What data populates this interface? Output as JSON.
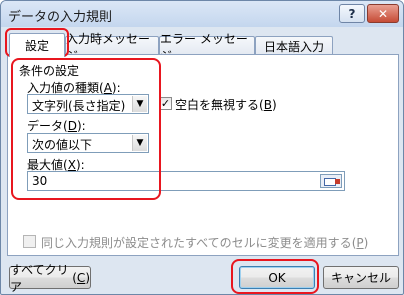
{
  "window": {
    "title": "データの入力規則",
    "help_label": "?",
    "close_label": "✕"
  },
  "tabs": [
    {
      "label": "設定",
      "active": true
    },
    {
      "label": "入力時メッセージ",
      "active": false
    },
    {
      "label": "エラー メッセージ",
      "active": false
    },
    {
      "label": "日本語入力",
      "active": false
    }
  ],
  "conditions": {
    "section_title": "条件の設定",
    "allow_label": "入力値の種類",
    "allow_key": "A",
    "allow_value": "文字列(長さ指定)",
    "ignore_blank_label": "空白を無視する",
    "ignore_blank_key": "B",
    "ignore_blank_checked": true,
    "data_label": "データ",
    "data_key": "D",
    "data_value": "次の値以下",
    "max_label": "最大値",
    "max_key": "X",
    "max_value": "30"
  },
  "apply_all": {
    "label": "同じ入力規則が設定されたすべてのセルに変更を適用する",
    "key": "P",
    "checked": false,
    "enabled": false
  },
  "buttons": {
    "clear_all": "すべてクリア",
    "clear_all_key": "C",
    "ok": "OK",
    "cancel": "キャンセル"
  }
}
